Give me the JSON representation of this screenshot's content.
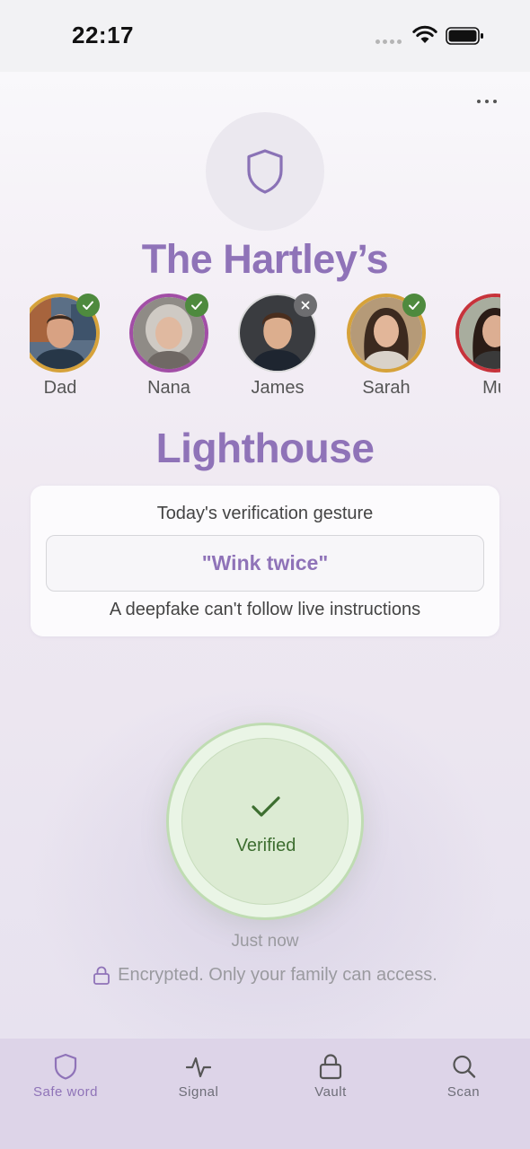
{
  "status_bar": {
    "time": "22:17"
  },
  "family": {
    "name": "The Hartley’s"
  },
  "members": [
    {
      "name": "Dad",
      "status": "verified",
      "ring_color": "#d6a23a"
    },
    {
      "name": "Nana",
      "status": "verified",
      "ring_color": "#a24ea6"
    },
    {
      "name": "James",
      "status": "not-verified",
      "ring_color": "#dadada"
    },
    {
      "name": "Sarah",
      "status": "verified",
      "ring_color": "#d6a23a"
    },
    {
      "name": "Mu",
      "status": "pending",
      "ring_color": "#c7333b"
    }
  ],
  "app": {
    "title": "Lighthouse"
  },
  "gesture_card": {
    "label": "Today's verification gesture",
    "gesture": "\"Wink twice\"",
    "note": "A deepfake can't follow live instructions"
  },
  "verification": {
    "status": "Verified",
    "time": "Just now",
    "encrypted_note": "Encrypted. Only your family can access."
  },
  "tabs": [
    {
      "label": "Safe word",
      "icon": "shield-icon",
      "active": true
    },
    {
      "label": "Signal",
      "icon": "pulse-icon",
      "active": false
    },
    {
      "label": "Vault",
      "icon": "lock-icon",
      "active": false
    },
    {
      "label": "Scan",
      "icon": "search-icon",
      "active": false
    }
  ],
  "colors": {
    "accent": "#8f73b8",
    "verified_green": "#4e8a3e",
    "tab_bar": "#ddd4e8"
  }
}
